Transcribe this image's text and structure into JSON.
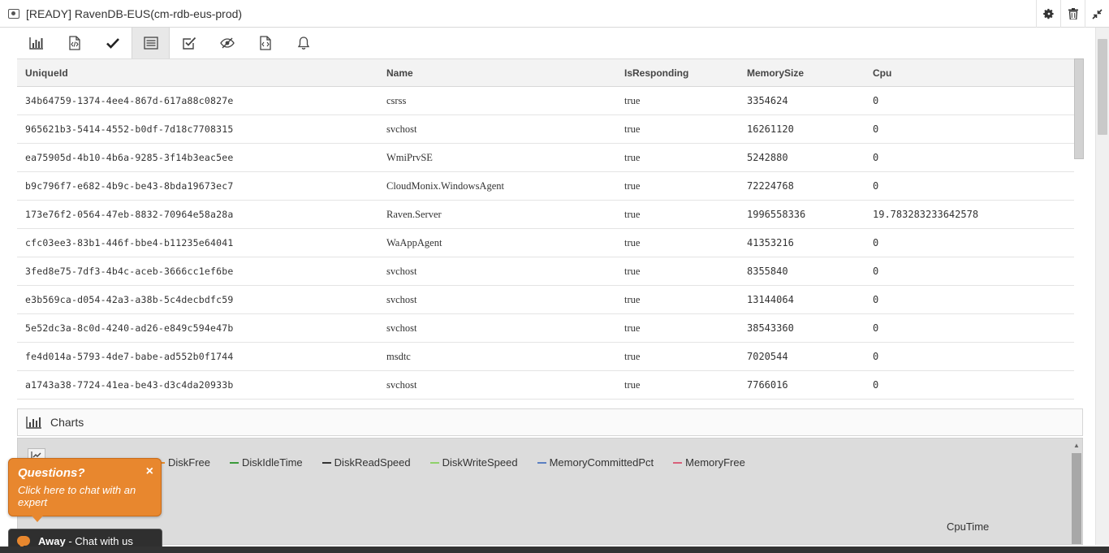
{
  "window": {
    "title": "[READY] RavenDB-EUS(cm-rdb-eus-prod)",
    "actions": [
      "gear-icon",
      "trash-icon",
      "collapse-icon"
    ]
  },
  "toolbar": {
    "buttons": [
      {
        "icon": "bar-chart-icon",
        "active": false
      },
      {
        "icon": "code-file-icon",
        "active": false
      },
      {
        "icon": "check-icon",
        "active": false
      },
      {
        "icon": "list-icon",
        "active": true
      },
      {
        "icon": "checkbox-icon",
        "active": false
      },
      {
        "icon": "eye-slash-icon",
        "active": false
      },
      {
        "icon": "script-file-icon",
        "active": false
      },
      {
        "icon": "bell-icon",
        "active": false
      }
    ]
  },
  "grid": {
    "columns": [
      "UniqueId",
      "Name",
      "IsResponding",
      "MemorySize",
      "Cpu"
    ],
    "rows": [
      [
        "34b64759-1374-4ee4-867d-617a88c0827e",
        "csrss",
        "true",
        "3354624",
        "0"
      ],
      [
        "965621b3-5414-4552-b0df-7d18c7708315",
        "svchost",
        "true",
        "16261120",
        "0"
      ],
      [
        "ea75905d-4b10-4b6a-9285-3f14b3eac5ee",
        "WmiPrvSE",
        "true",
        "5242880",
        "0"
      ],
      [
        "b9c796f7-e682-4b9c-be43-8bda19673ec7",
        "CloudMonix.WindowsAgent",
        "true",
        "72224768",
        "0"
      ],
      [
        "173e76f2-0564-47eb-8832-70964e58a28a",
        "Raven.Server",
        "true",
        "1996558336",
        "19.783283233642578"
      ],
      [
        "cfc03ee3-83b1-446f-bbe4-b11235e64041",
        "WaAppAgent",
        "true",
        "41353216",
        "0"
      ],
      [
        "3fed8e75-7df3-4b4c-aceb-3666cc1ef6be",
        "svchost",
        "true",
        "8355840",
        "0"
      ],
      [
        "e3b569ca-d054-42a3-a38b-5c4decbdfc59",
        "svchost",
        "true",
        "13144064",
        "0"
      ],
      [
        "5e52dc3a-8c0d-4240-ad26-e849c594e47b",
        "svchost",
        "true",
        "38543360",
        "0"
      ],
      [
        "fe4d014a-5793-4de7-babe-ad552b0f1744",
        "msdtc",
        "true",
        "7020544",
        "0"
      ],
      [
        "a1743a38-7724-41ea-be43-d3c4da20933b",
        "svchost",
        "true",
        "7766016",
        "0"
      ]
    ]
  },
  "charts": {
    "title": "Charts",
    "legend": [
      {
        "label": "DiskFree",
        "color": "#e58b2a"
      },
      {
        "label": "DiskIdleTime",
        "color": "#3a9a3a"
      },
      {
        "label": "DiskReadSpeed",
        "color": "#333333"
      },
      {
        "label": "DiskWriteSpeed",
        "color": "#8fd16a"
      },
      {
        "label": "MemoryCommittedPct",
        "color": "#5b7fc2"
      },
      {
        "label": "MemoryFree",
        "color": "#d9607a"
      }
    ],
    "axis_label": "CpuTime"
  },
  "chat": {
    "heading": "Questions?",
    "close": "×",
    "subtitle": "Click here to chat with an expert",
    "status": "Away",
    "status_text": " - Chat with us"
  }
}
